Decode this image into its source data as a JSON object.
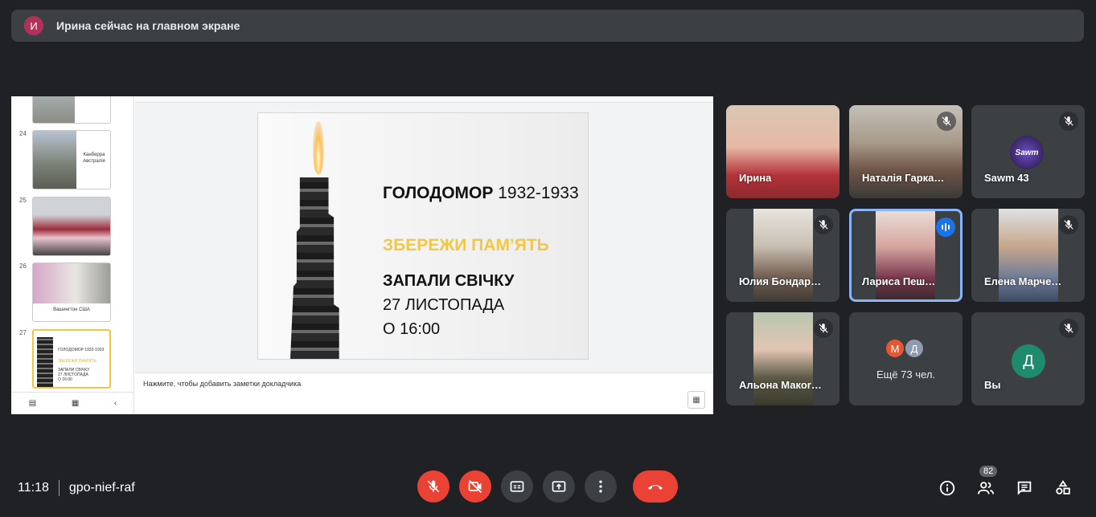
{
  "banner": {
    "avatar_letter": "И",
    "text": "Ирина сейчас на главном экране"
  },
  "slides_panel": {
    "thumbs": [
      {
        "num": "",
        "caption": ""
      },
      {
        "num": "24",
        "caption": "Канберра Австралія"
      },
      {
        "num": "25",
        "caption": ""
      },
      {
        "num": "26",
        "caption": "Вашингтон США"
      },
      {
        "num": "27",
        "caption": ""
      }
    ]
  },
  "slide": {
    "title_bold": "ГОЛОДОМОР",
    "title_years": "1932-1933",
    "line2": "ЗБЕРЕЖИ ПАМ’ЯТЬ",
    "line3": "ЗАПАЛИ СВІЧКУ",
    "line4": "27 ЛИСТОПАДА",
    "line5": "О 16:00",
    "accent_color": "#f2c744"
  },
  "notes": {
    "placeholder": "Нажмите, чтобы добавить заметки докладчика"
  },
  "participants": [
    {
      "name": "Ирина"
    },
    {
      "name": "Наталія Гарка…"
    },
    {
      "name": "Sawm 43"
    },
    {
      "name": "Юлия Бондар…"
    },
    {
      "name": "Лариса Пеш…"
    },
    {
      "name": "Елена Марче…"
    },
    {
      "name": "Альона Макоr…"
    },
    {
      "name": "Ещё 73 чел.",
      "avatars": [
        "М",
        "Д"
      ]
    },
    {
      "name": "Вы",
      "avatar": "Д"
    }
  ],
  "meeting": {
    "time": "11:18",
    "code": "gpo-nief-raf",
    "people_count": "82"
  }
}
